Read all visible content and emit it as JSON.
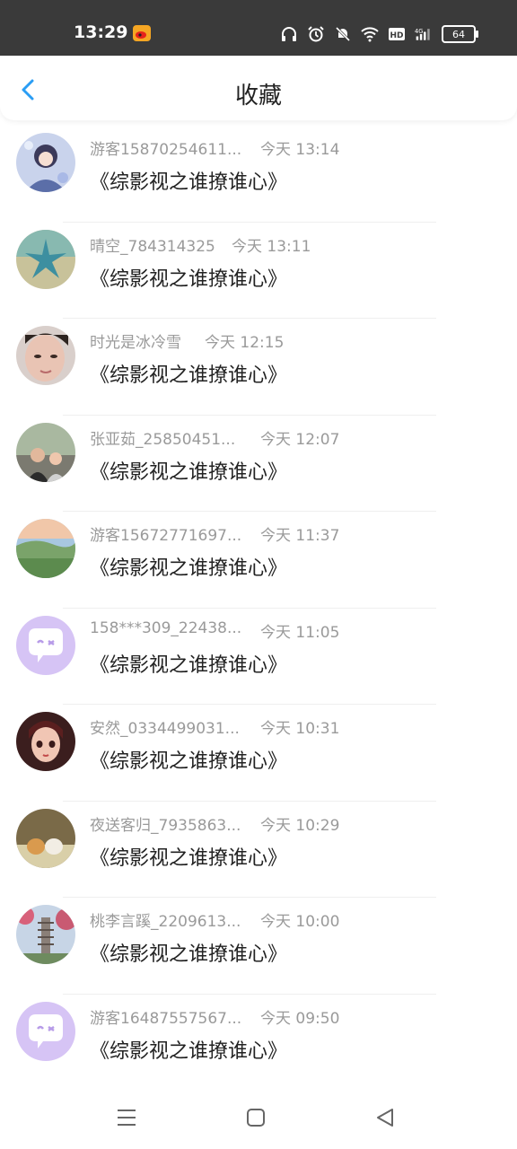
{
  "statusbar": {
    "time": "13:29",
    "battery": "64"
  },
  "header": {
    "title": "收藏"
  },
  "items": [
    {
      "name": "游客15870254611...",
      "time": "今天 13:14",
      "title": "《综影视之谁撩谁心》",
      "avatar": "anime-girl-avatar"
    },
    {
      "name": "晴空_784314325",
      "time": "今天 13:11",
      "title": "《综影视之谁撩谁心》",
      "avatar": "starfish-avatar"
    },
    {
      "name": "时光是冰冷雪",
      "time": "今天 12:15",
      "title": "《综影视之谁撩谁心》",
      "avatar": "face-avatar"
    },
    {
      "name": "张亚茹_25850451...",
      "time": "今天 12:07",
      "title": "《综影视之谁撩谁心》",
      "avatar": "couple-avatar"
    },
    {
      "name": "游客15672771697...",
      "time": "今天 11:37",
      "title": "《综影视之谁撩谁心》",
      "avatar": "landscape-avatar"
    },
    {
      "name": "158***309_22438...",
      "time": "今天 11:05",
      "title": "《综影视之谁撩谁心》",
      "avatar": "default-chat-avatar"
    },
    {
      "name": "安然_0334499031...",
      "time": "今天 10:31",
      "title": "《综影视之谁撩谁心》",
      "avatar": "doll-avatar"
    },
    {
      "name": "夜送客归_7935863...",
      "time": "今天 10:29",
      "title": "《综影视之谁撩谁心》",
      "avatar": "dog-avatar"
    },
    {
      "name": "桃李言蹊_2209613...",
      "time": "今天 10:00",
      "title": "《综影视之谁撩谁心》",
      "avatar": "pagoda-avatar"
    },
    {
      "name": "游客16487557567...",
      "time": "今天 09:50",
      "title": "《综影视之谁撩谁心》",
      "avatar": "default-chat-avatar"
    }
  ],
  "colors": {
    "accent": "#2a9df4",
    "statusbar": "#3a3a3a",
    "meta": "#9a9a9a",
    "default_avatar": "#d6c4f5"
  }
}
